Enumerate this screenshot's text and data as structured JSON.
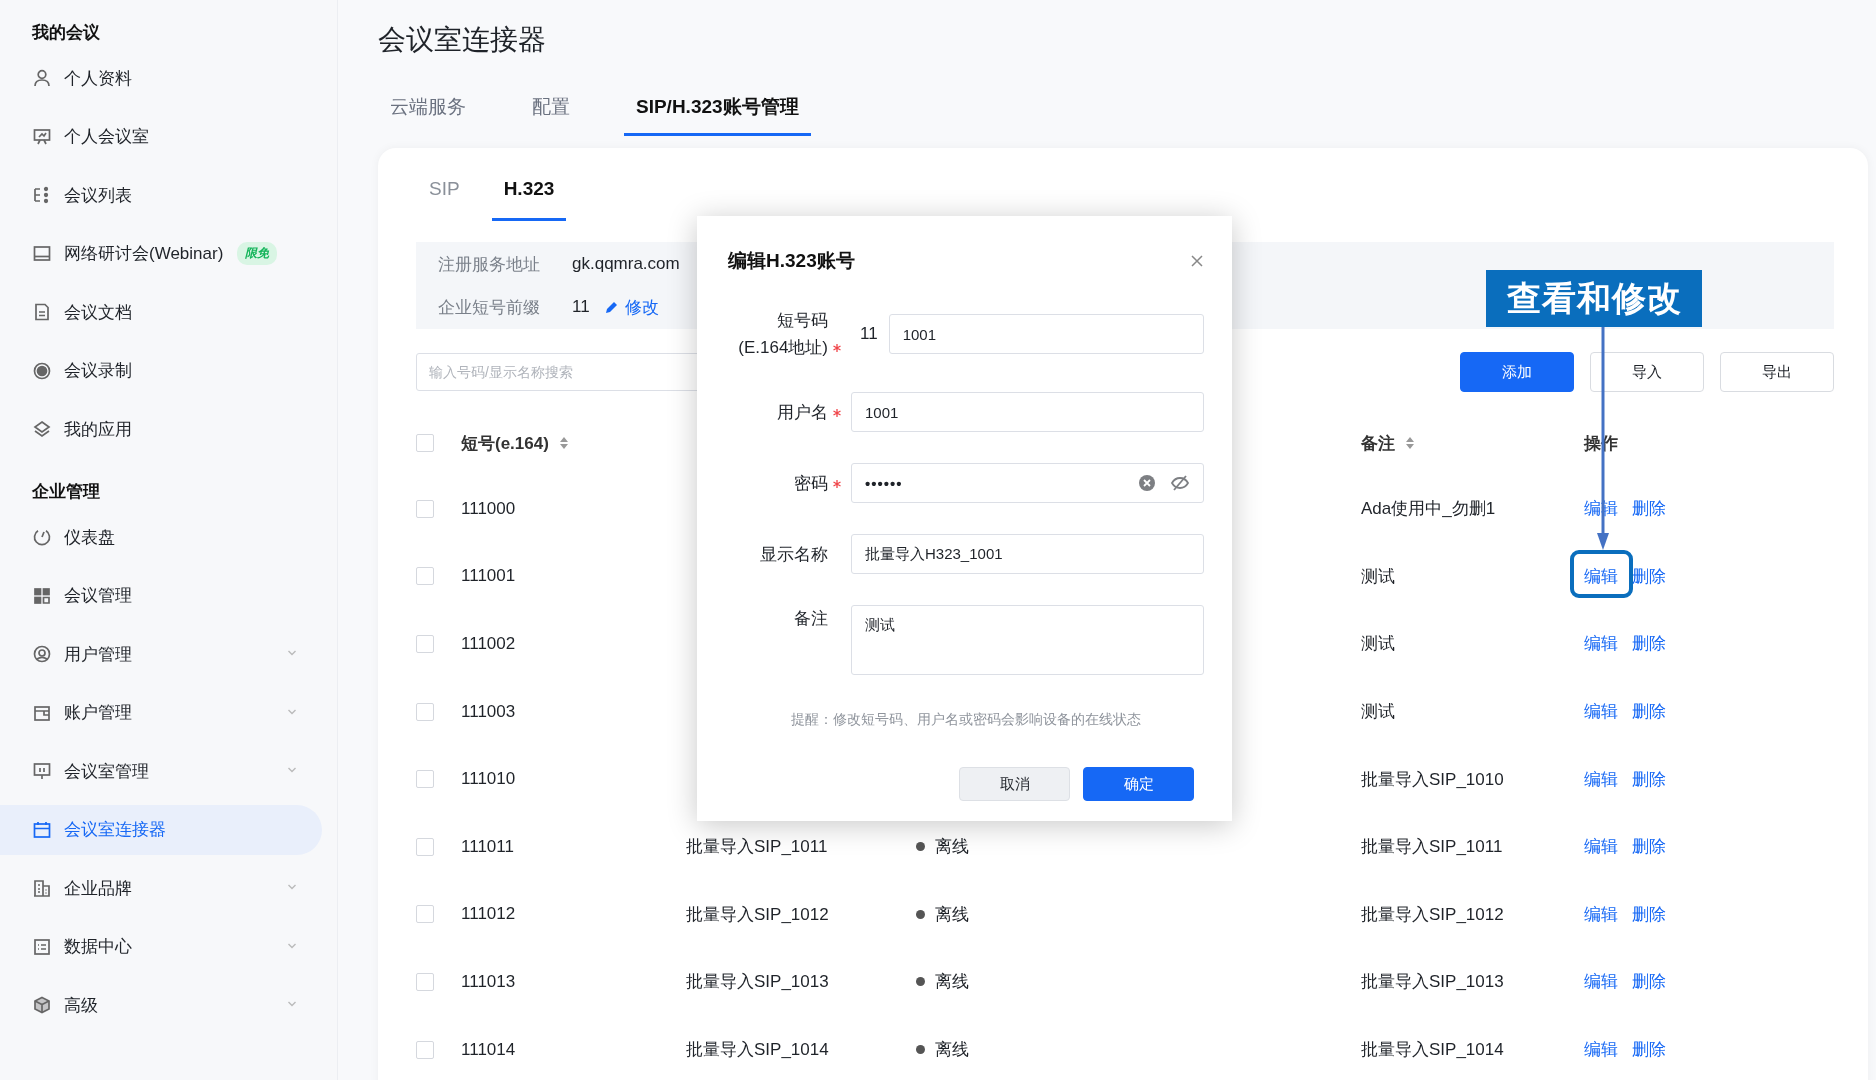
{
  "sidebar": {
    "sections": [
      {
        "title": "我的会议",
        "items": [
          {
            "label": "个人资料",
            "selected": false,
            "has_submenu": false
          },
          {
            "label": "个人会议室",
            "selected": false,
            "has_submenu": false
          },
          {
            "label": "会议列表",
            "selected": false,
            "has_submenu": false
          },
          {
            "label": "网络研讨会(Webinar)",
            "selected": false,
            "has_submenu": false,
            "badge": "限免"
          },
          {
            "label": "会议文档",
            "selected": false,
            "has_submenu": false
          },
          {
            "label": "会议录制",
            "selected": false,
            "has_submenu": false
          },
          {
            "label": "我的应用",
            "selected": false,
            "has_submenu": false
          }
        ]
      },
      {
        "title": "企业管理",
        "items": [
          {
            "label": "仪表盘",
            "selected": false,
            "has_submenu": false
          },
          {
            "label": "会议管理",
            "selected": false,
            "has_submenu": false
          },
          {
            "label": "用户管理",
            "selected": false,
            "has_submenu": true
          },
          {
            "label": "账户管理",
            "selected": false,
            "has_submenu": true
          },
          {
            "label": "会议室管理",
            "selected": false,
            "has_submenu": true
          },
          {
            "label": "会议室连接器",
            "selected": true,
            "has_submenu": false
          },
          {
            "label": "企业品牌",
            "selected": false,
            "has_submenu": true
          },
          {
            "label": "数据中心",
            "selected": false,
            "has_submenu": true
          },
          {
            "label": "高级",
            "selected": false,
            "has_submenu": true
          }
        ]
      }
    ]
  },
  "page_title": "会议室连接器",
  "tabs": [
    {
      "label": "云端服务",
      "selected": false
    },
    {
      "label": "配置",
      "selected": false
    },
    {
      "label": "SIP/H.323账号管理",
      "selected": true
    }
  ],
  "subtabs": [
    {
      "label": "SIP",
      "selected": false
    },
    {
      "label": "H.323",
      "selected": true
    }
  ],
  "info": [
    {
      "label": "注册服务地址",
      "value": "gk.qqmra.com"
    },
    {
      "label": "企业短号前缀",
      "value": "11",
      "action": "修改"
    }
  ],
  "search": {
    "placeholder": "输入号码/显示名称搜索"
  },
  "toolbar_buttons": [
    {
      "label": "添加",
      "kind": "primary"
    },
    {
      "label": "导入",
      "kind": "default"
    },
    {
      "label": "导出",
      "kind": "default"
    }
  ],
  "table": {
    "select_all": {
      "checked": false
    },
    "columns": [
      {
        "label": "短号(e.164)",
        "sortable": true
      },
      {
        "label": "备注",
        "sortable": true
      },
      {
        "label": "操作",
        "sortable": false
      }
    ],
    "rows": [
      {
        "checked": false,
        "number": "111000",
        "remark": "Ada使用中_勿删1",
        "actions": [
          "编辑",
          "删除"
        ]
      },
      {
        "checked": false,
        "number": "111001",
        "remark": "测试",
        "actions": [
          "编辑",
          "删除"
        ]
      },
      {
        "checked": false,
        "number": "111002",
        "remark": "测试",
        "actions": [
          "编辑",
          "删除"
        ]
      },
      {
        "checked": false,
        "number": "111003",
        "remark": "测试",
        "actions": [
          "编辑",
          "删除"
        ]
      },
      {
        "checked": false,
        "number": "111010",
        "remark": "批量导入SIP_1010",
        "actions": [
          "编辑",
          "删除"
        ]
      },
      {
        "checked": false,
        "number": "111011",
        "display_name": "批量导入SIP_1011",
        "status": "离线",
        "remark": "批量导入SIP_1011",
        "actions": [
          "编辑",
          "删除"
        ]
      },
      {
        "checked": false,
        "number": "111012",
        "display_name": "批量导入SIP_1012",
        "status": "离线",
        "remark": "批量导入SIP_1012",
        "actions": [
          "编辑",
          "删除"
        ]
      },
      {
        "checked": false,
        "number": "111013",
        "display_name": "批量导入SIP_1013",
        "status": "离线",
        "remark": "批量导入SIP_1013",
        "actions": [
          "编辑",
          "删除"
        ]
      },
      {
        "checked": false,
        "number": "111014",
        "display_name": "批量导入SIP_1014",
        "status": "离线",
        "remark": "批量导入SIP_1014",
        "actions": [
          "编辑",
          "删除"
        ]
      }
    ]
  },
  "dialog": {
    "title": "编辑H.323账号",
    "fields": [
      {
        "kind": "prefixed",
        "label": "短号码",
        "sublabel": "(E.164地址)",
        "required": true,
        "prefix": "11",
        "value": "1001"
      },
      {
        "kind": "text",
        "label": "用户名",
        "required": true,
        "value": "1001"
      },
      {
        "kind": "password",
        "label": "密码",
        "required": true,
        "value": "••••••"
      },
      {
        "kind": "text",
        "label": "显示名称",
        "required": false,
        "value": "批量导入H323_1001"
      },
      {
        "kind": "textarea",
        "label": "备注",
        "required": false,
        "value": "测试"
      }
    ],
    "hint": "提醒：修改短号码、用户名或密码会影响设备的在线状态",
    "buttons": [
      {
        "label": "取消",
        "kind": "default"
      },
      {
        "label": "确定",
        "kind": "primary"
      }
    ]
  },
  "annotation": {
    "callout": "查看和修改"
  }
}
